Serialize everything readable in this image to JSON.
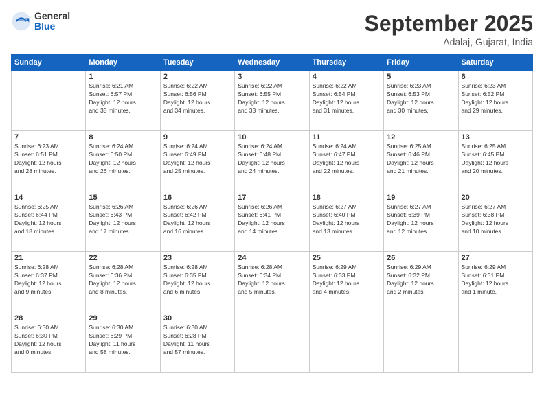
{
  "logo": {
    "general": "General",
    "blue": "Blue"
  },
  "title": "September 2025",
  "location": "Adalaj, Gujarat, India",
  "days_header": [
    "Sunday",
    "Monday",
    "Tuesday",
    "Wednesday",
    "Thursday",
    "Friday",
    "Saturday"
  ],
  "weeks": [
    [
      {
        "day": "",
        "info": ""
      },
      {
        "day": "1",
        "info": "Sunrise: 6:21 AM\nSunset: 6:57 PM\nDaylight: 12 hours\nand 35 minutes."
      },
      {
        "day": "2",
        "info": "Sunrise: 6:22 AM\nSunset: 6:56 PM\nDaylight: 12 hours\nand 34 minutes."
      },
      {
        "day": "3",
        "info": "Sunrise: 6:22 AM\nSunset: 6:55 PM\nDaylight: 12 hours\nand 33 minutes."
      },
      {
        "day": "4",
        "info": "Sunrise: 6:22 AM\nSunset: 6:54 PM\nDaylight: 12 hours\nand 31 minutes."
      },
      {
        "day": "5",
        "info": "Sunrise: 6:23 AM\nSunset: 6:53 PM\nDaylight: 12 hours\nand 30 minutes."
      },
      {
        "day": "6",
        "info": "Sunrise: 6:23 AM\nSunset: 6:52 PM\nDaylight: 12 hours\nand 29 minutes."
      }
    ],
    [
      {
        "day": "7",
        "info": "Sunrise: 6:23 AM\nSunset: 6:51 PM\nDaylight: 12 hours\nand 28 minutes."
      },
      {
        "day": "8",
        "info": "Sunrise: 6:24 AM\nSunset: 6:50 PM\nDaylight: 12 hours\nand 26 minutes."
      },
      {
        "day": "9",
        "info": "Sunrise: 6:24 AM\nSunset: 6:49 PM\nDaylight: 12 hours\nand 25 minutes."
      },
      {
        "day": "10",
        "info": "Sunrise: 6:24 AM\nSunset: 6:48 PM\nDaylight: 12 hours\nand 24 minutes."
      },
      {
        "day": "11",
        "info": "Sunrise: 6:24 AM\nSunset: 6:47 PM\nDaylight: 12 hours\nand 22 minutes."
      },
      {
        "day": "12",
        "info": "Sunrise: 6:25 AM\nSunset: 6:46 PM\nDaylight: 12 hours\nand 21 minutes."
      },
      {
        "day": "13",
        "info": "Sunrise: 6:25 AM\nSunset: 6:45 PM\nDaylight: 12 hours\nand 20 minutes."
      }
    ],
    [
      {
        "day": "14",
        "info": "Sunrise: 6:25 AM\nSunset: 6:44 PM\nDaylight: 12 hours\nand 18 minutes."
      },
      {
        "day": "15",
        "info": "Sunrise: 6:26 AM\nSunset: 6:43 PM\nDaylight: 12 hours\nand 17 minutes."
      },
      {
        "day": "16",
        "info": "Sunrise: 6:26 AM\nSunset: 6:42 PM\nDaylight: 12 hours\nand 16 minutes."
      },
      {
        "day": "17",
        "info": "Sunrise: 6:26 AM\nSunset: 6:41 PM\nDaylight: 12 hours\nand 14 minutes."
      },
      {
        "day": "18",
        "info": "Sunrise: 6:27 AM\nSunset: 6:40 PM\nDaylight: 12 hours\nand 13 minutes."
      },
      {
        "day": "19",
        "info": "Sunrise: 6:27 AM\nSunset: 6:39 PM\nDaylight: 12 hours\nand 12 minutes."
      },
      {
        "day": "20",
        "info": "Sunrise: 6:27 AM\nSunset: 6:38 PM\nDaylight: 12 hours\nand 10 minutes."
      }
    ],
    [
      {
        "day": "21",
        "info": "Sunrise: 6:28 AM\nSunset: 6:37 PM\nDaylight: 12 hours\nand 9 minutes."
      },
      {
        "day": "22",
        "info": "Sunrise: 6:28 AM\nSunset: 6:36 PM\nDaylight: 12 hours\nand 8 minutes."
      },
      {
        "day": "23",
        "info": "Sunrise: 6:28 AM\nSunset: 6:35 PM\nDaylight: 12 hours\nand 6 minutes."
      },
      {
        "day": "24",
        "info": "Sunrise: 6:28 AM\nSunset: 6:34 PM\nDaylight: 12 hours\nand 5 minutes."
      },
      {
        "day": "25",
        "info": "Sunrise: 6:29 AM\nSunset: 6:33 PM\nDaylight: 12 hours\nand 4 minutes."
      },
      {
        "day": "26",
        "info": "Sunrise: 6:29 AM\nSunset: 6:32 PM\nDaylight: 12 hours\nand 2 minutes."
      },
      {
        "day": "27",
        "info": "Sunrise: 6:29 AM\nSunset: 6:31 PM\nDaylight: 12 hours\nand 1 minute."
      }
    ],
    [
      {
        "day": "28",
        "info": "Sunrise: 6:30 AM\nSunset: 6:30 PM\nDaylight: 12 hours\nand 0 minutes."
      },
      {
        "day": "29",
        "info": "Sunrise: 6:30 AM\nSunset: 6:29 PM\nDaylight: 11 hours\nand 58 minutes."
      },
      {
        "day": "30",
        "info": "Sunrise: 6:30 AM\nSunset: 6:28 PM\nDaylight: 11 hours\nand 57 minutes."
      },
      {
        "day": "",
        "info": ""
      },
      {
        "day": "",
        "info": ""
      },
      {
        "day": "",
        "info": ""
      },
      {
        "day": "",
        "info": ""
      }
    ]
  ]
}
